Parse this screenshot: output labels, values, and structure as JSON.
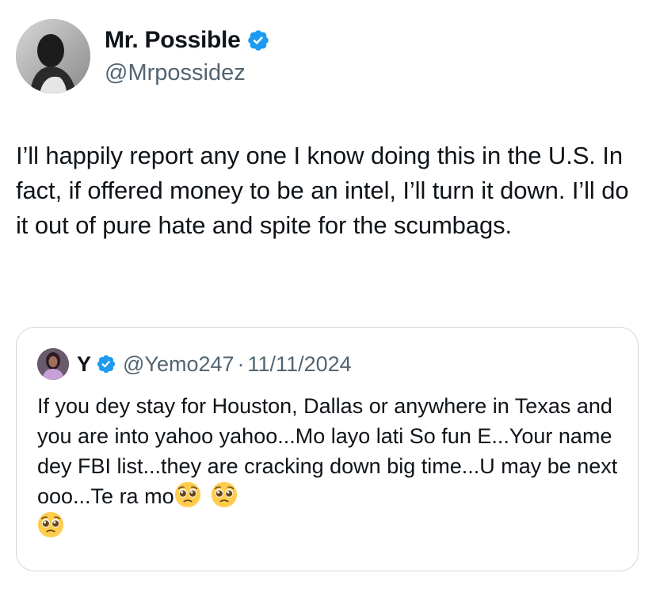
{
  "tweet": {
    "author": {
      "display_name": "Mr. Possible",
      "handle": "@Mrpossidez",
      "verified": true
    },
    "text": "I’ll happily report any one I know doing this in the U.S. In fact, if offered money to be an intel, I’ll turn it down. I’ll do it out of pure hate and spite for the scumbags."
  },
  "quoted_tweet": {
    "author": {
      "display_name": "Y",
      "handle": "@Yemo247",
      "verified": true
    },
    "separator": "·",
    "date": "11/11/2024",
    "text": "If you dey stay for Houston, Dallas or anywhere in Texas and you are into yahoo yahoo...Mo layo lati So fun E...Your name dey FBI list...they are cracking down big time...U may be next ooo...Te ra mo",
    "emojis": [
      "pleading-face-emoji",
      "pleading-face-emoji",
      "pleading-face-emoji"
    ]
  },
  "colors": {
    "text": "#0f1419",
    "secondary": "#536471",
    "verified": "#1d9bf0",
    "border": "#cfd9de",
    "emoji": "#ffcc4d"
  }
}
